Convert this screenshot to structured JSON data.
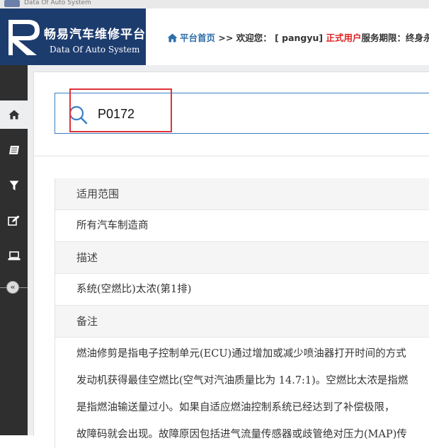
{
  "window": {
    "title": "Data Of Auto System"
  },
  "logo": {
    "brand_cn": "畅易汽车维修平台",
    "brand_en": "Data Of Auto System"
  },
  "header": {
    "home_link": "平台首页",
    "separator": ">>",
    "welcome": "欢迎您：",
    "username": "[ pangyu]",
    "user_type": "正式用户",
    "service_label": "服务期限：",
    "service_value": "终身永"
  },
  "sidebar": {
    "items": [
      {
        "icon": "home-icon"
      },
      {
        "icon": "book-icon"
      },
      {
        "icon": "filter-icon"
      },
      {
        "icon": "edit-icon"
      },
      {
        "icon": "laptop-icon"
      }
    ],
    "collapse_label": "«"
  },
  "search": {
    "value": "P0172"
  },
  "info": {
    "scope_label": "适用范围",
    "scope_value": "所有汽车制造商",
    "desc_label": "描述",
    "desc_value": "系统(空燃比)太浓(第1排)",
    "notes_label": "备注",
    "notes_lines": [
      "燃油修剪是指电子控制单元(ECU)通过增加或减少喷油器打开时间的方式",
      "发动机获得最佳空燃比(空气对汽油质量比为 14.7:1)。空燃比太浓是指燃",
      "是指燃油输送量过小。如果自适应燃油控制系统已经达到了补偿极限，",
      "故障码就会出现。故障原因包括进气流量传感器或歧管绝对压力(MAP)传"
    ]
  },
  "colors": {
    "logo_bg": "#1d3c6e",
    "accent_blue": "#3b7fc4",
    "user_type_red": "#e02020",
    "highlight": "#e0323a"
  }
}
